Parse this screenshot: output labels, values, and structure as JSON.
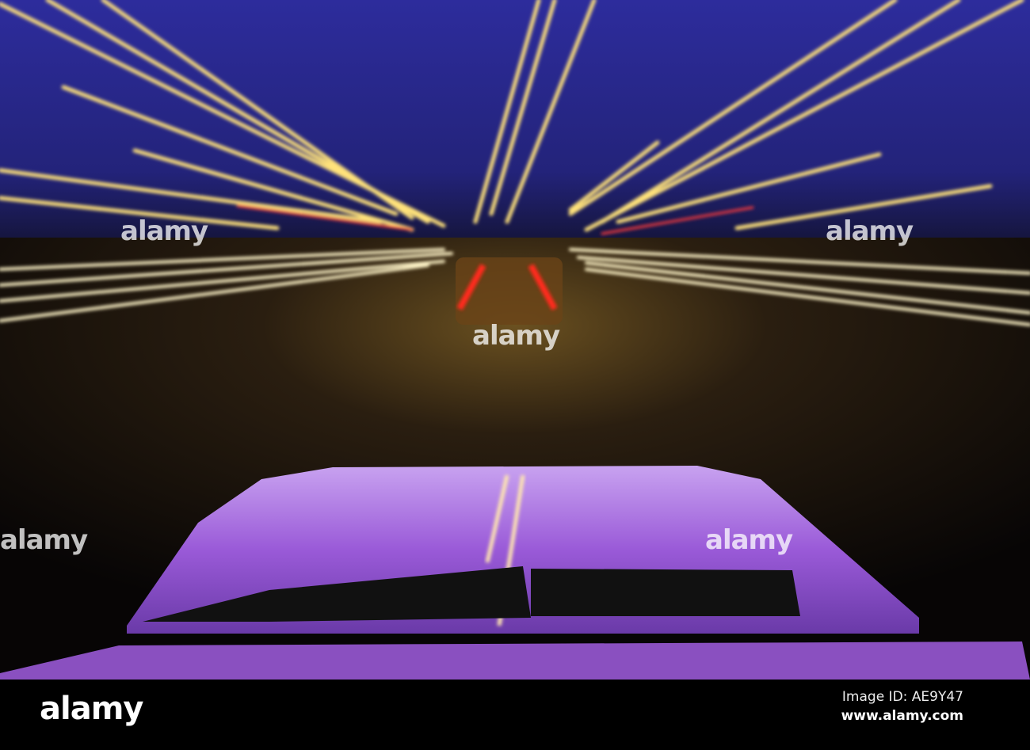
{
  "watermark": "alamy",
  "footer": {
    "logo": "alamy",
    "image_id": "Image ID: AE9Y47",
    "url": "www.alamy.com"
  },
  "colors": {
    "sky": "#2a2a8e",
    "hood": "#9a5ad8",
    "streak": "#ffe27a"
  }
}
